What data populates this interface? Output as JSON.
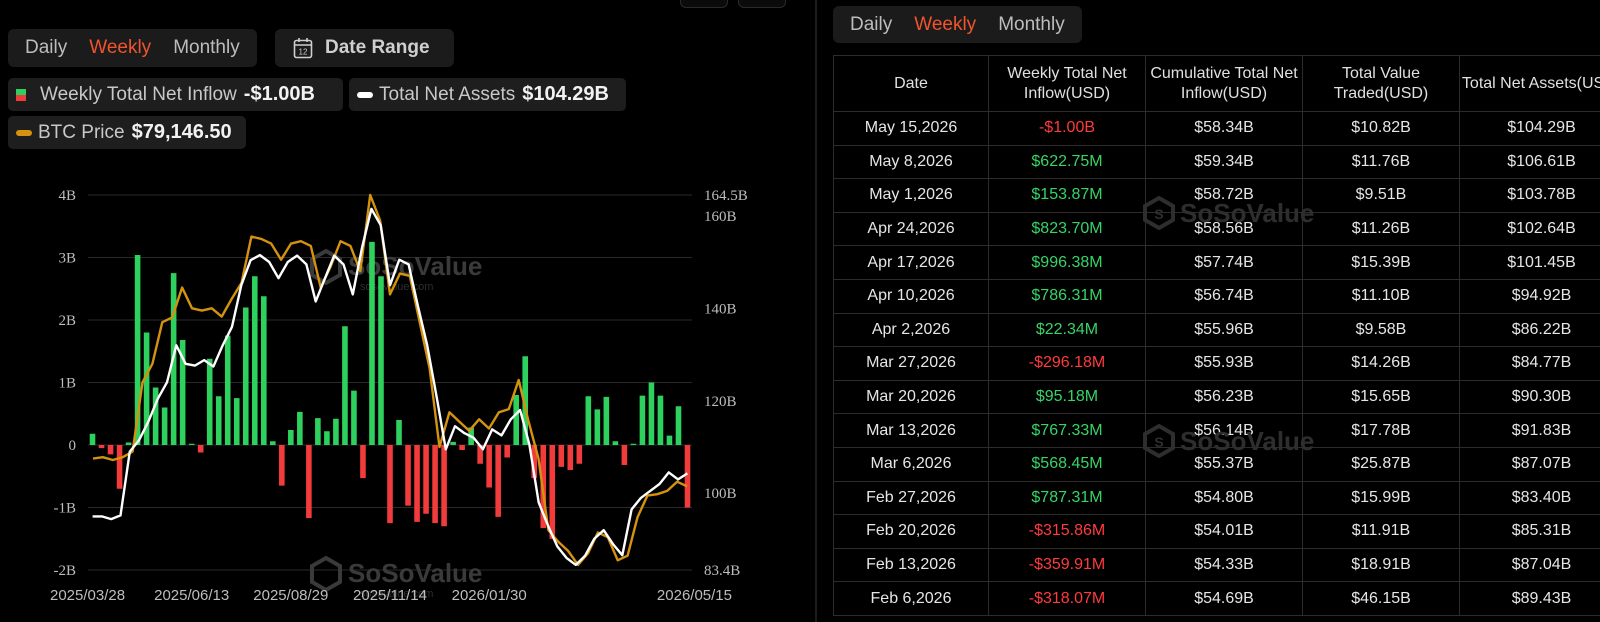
{
  "left": {
    "tabs": [
      "Daily",
      "Weekly",
      "Monthly"
    ],
    "active_tab": "Weekly",
    "date_range_label": "Date Range",
    "legend": {
      "inflow_label": "Weekly Total Net Inflow",
      "inflow_value": "-$1.00B",
      "assets_label": "Total Net Assets",
      "assets_value": "$104.29B",
      "btc_label": "BTC Price",
      "btc_value": "$79,146.50"
    },
    "watermark": "SoSoValue",
    "watermark_sub": "sosovalue.com"
  },
  "right": {
    "tabs": [
      "Daily",
      "Weekly",
      "Monthly"
    ],
    "active_tab": "Weekly",
    "watermark": "SoSoValue",
    "columns": [
      "Date",
      "Weekly Total Net Inflow(USD)",
      "Cumulative Total Net Inflow(USD)",
      "Total Value Traded(USD)",
      "Total Net Assets(USD)"
    ],
    "rows": [
      [
        "May 15,2026",
        "-$1.00B",
        "$58.34B",
        "$10.82B",
        "$104.29B"
      ],
      [
        "May 8,2026",
        "$622.75M",
        "$59.34B",
        "$11.76B",
        "$106.61B"
      ],
      [
        "May 1,2026",
        "$153.87M",
        "$58.72B",
        "$9.51B",
        "$103.78B"
      ],
      [
        "Apr 24,2026",
        "$823.70M",
        "$58.56B",
        "$11.26B",
        "$102.64B"
      ],
      [
        "Apr 17,2026",
        "$996.38M",
        "$57.74B",
        "$15.39B",
        "$101.45B"
      ],
      [
        "Apr 10,2026",
        "$786.31M",
        "$56.74B",
        "$11.10B",
        "$94.92B"
      ],
      [
        "Apr 2,2026",
        "$22.34M",
        "$55.96B",
        "$9.58B",
        "$86.22B"
      ],
      [
        "Mar 27,2026",
        "-$296.18M",
        "$55.93B",
        "$14.26B",
        "$84.77B"
      ],
      [
        "Mar 20,2026",
        "$95.18M",
        "$56.23B",
        "$15.65B",
        "$90.30B"
      ],
      [
        "Mar 13,2026",
        "$767.33M",
        "$56.14B",
        "$17.78B",
        "$91.83B"
      ],
      [
        "Mar 6,2026",
        "$568.45M",
        "$55.37B",
        "$25.87B",
        "$87.07B"
      ],
      [
        "Feb 27,2026",
        "$787.31M",
        "$54.80B",
        "$15.99B",
        "$83.40B"
      ],
      [
        "Feb 20,2026",
        "-$315.86M",
        "$54.01B",
        "$11.91B",
        "$85.31B"
      ],
      [
        "Feb 13,2026",
        "-$359.91M",
        "$54.33B",
        "$18.91B",
        "$87.04B"
      ],
      [
        "Feb 6,2026",
        "-$318.07M",
        "$54.69B",
        "$46.15B",
        "$89.43B"
      ]
    ]
  },
  "colors": {
    "accent": "#f0542d",
    "positive": "#2fd15e",
    "negative": "#f23b3b",
    "assets_line": "#ffffff",
    "btc_line": "#d4920f"
  },
  "chart_data": {
    "type": "bar",
    "left_axis": {
      "ticks": [
        "4B",
        "3B",
        "2B",
        "1B",
        "0",
        "-1B",
        "-2B"
      ],
      "tick_values": [
        4,
        3,
        2,
        1,
        0,
        -1,
        -2
      ],
      "ylim": [
        -2,
        4
      ],
      "unit": "B USD"
    },
    "right_axis": {
      "ticks": [
        "164.5B",
        "160B",
        "140B",
        "120B",
        "100B",
        "83.4B"
      ],
      "tick_values": [
        164.5,
        160,
        140,
        120,
        100,
        83.4
      ],
      "ylim": [
        83.4,
        164.5
      ],
      "unit": "B USD"
    },
    "x_ticks": [
      "2025/03/28",
      "2025/06/13",
      "2025/08/29",
      "2025/11/14",
      "2026/01/30",
      "2026/05/15"
    ],
    "x_tick_index": [
      0,
      11,
      22,
      33,
      44,
      59
    ],
    "grid": true,
    "series": [
      {
        "name": "Weekly Total Net Inflow",
        "type": "bar",
        "axis": "left",
        "values": [
          0.18,
          -0.05,
          -0.15,
          -0.7,
          0.04,
          3.04,
          1.8,
          0.92,
          0.6,
          2.75,
          1.68,
          0.02,
          -0.12,
          1.38,
          0.78,
          1.75,
          0.75,
          2.2,
          2.7,
          2.38,
          0.06,
          -0.65,
          0.24,
          0.53,
          -1.17,
          0.43,
          0.22,
          0.42,
          1.9,
          0.87,
          -0.53,
          3.25,
          2.7,
          -1.25,
          0.4,
          -0.97,
          -1.23,
          -1.1,
          -1.25,
          -1.3,
          0.05,
          -0.08,
          0.28,
          -0.3,
          -0.68,
          -1.15,
          -0.2,
          0.8,
          1.42,
          -0.53,
          -1.33,
          -1.5,
          -0.35,
          -0.4,
          -0.3,
          0.78,
          0.57,
          0.77,
          0.06,
          -0.32,
          0.02,
          0.79,
          1.0,
          0.79,
          0.15,
          0.62,
          -1.0
        ]
      },
      {
        "name": "Total Net Assets",
        "type": "line",
        "axis": "right",
        "values": [
          95,
          95,
          94.4,
          95.2,
          109,
          111.5,
          115.5,
          120.4,
          124,
          132,
          128,
          127.6,
          128.8,
          127.4,
          132,
          136,
          145,
          150.4,
          151.5,
          150,
          146.5,
          150,
          151.4,
          149.5,
          141.5,
          146.5,
          151.4,
          149.5,
          143,
          153.2,
          161.5,
          158,
          145,
          150.5,
          149.5,
          140.5,
          132,
          121,
          109.5,
          114.5,
          113,
          112,
          109.5,
          113.8,
          112.5,
          116,
          118,
          110.5,
          98,
          93,
          88.5,
          86,
          84.5,
          86.5,
          90.2,
          92,
          89,
          86.6,
          96.5,
          99,
          100.5,
          102,
          104.5,
          103,
          104.29
        ]
      },
      {
        "name": "BTC Price",
        "type": "line",
        "axis": "right",
        "values": [
          107.5,
          107.8,
          107.2,
          107.8,
          109,
          124,
          128,
          137,
          138,
          144.5,
          140,
          139.5,
          140,
          138.2,
          142,
          145.5,
          155.5,
          155,
          154,
          150.5,
          154,
          154.5,
          153.5,
          144.5,
          149,
          154.5,
          153.5,
          148,
          164.5,
          159,
          143,
          147.5,
          147,
          137,
          127,
          110,
          117.5,
          115.5,
          113.5,
          116,
          114,
          117.5,
          118.2,
          124.5,
          115.5,
          107.5,
          92,
          89.5,
          87.5,
          84.5,
          87,
          91.5,
          90.5,
          85.5,
          86.5,
          94.8,
          99.5,
          99.8,
          100.5,
          102.5,
          101.5
        ]
      }
    ]
  }
}
